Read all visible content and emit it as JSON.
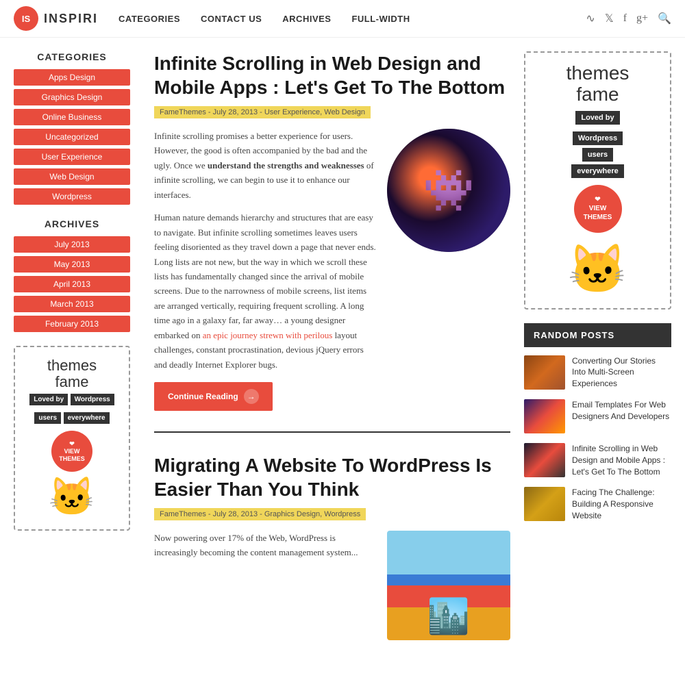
{
  "header": {
    "logo_initials": "IS",
    "logo_name": "INSPIRI",
    "nav": [
      {
        "label": "CATEGORIES",
        "id": "nav-categories"
      },
      {
        "label": "CONTACT US",
        "id": "nav-contact"
      },
      {
        "label": "ARCHIVES",
        "id": "nav-archives"
      },
      {
        "label": "FULL-WIDTH",
        "id": "nav-fullwidth"
      }
    ],
    "icons": [
      "rss-icon",
      "twitter-icon",
      "facebook-icon",
      "gplus-icon",
      "search-icon"
    ]
  },
  "sidebar": {
    "categories_title": "CATEGORIES",
    "categories": [
      "Apps Design",
      "Graphics Design",
      "Online Business",
      "Uncategorized",
      "User Experience",
      "Web Design",
      "Wordpress"
    ],
    "archives_title": "ARCHIVES",
    "archives": [
      "July 2013",
      "May 2013",
      "April 2013",
      "March 2013",
      "February 2013"
    ],
    "ad": {
      "script_line1": "themes",
      "script_line2": "fame",
      "tagline1": "Loved by",
      "tagline2": "Wordpress",
      "tagline3": "users",
      "tagline4": "everywhere",
      "badge_line1": "❤",
      "badge_line2": "VIEW",
      "badge_line3": "THEMES"
    }
  },
  "articles": [
    {
      "title": "Infinite Scrolling in Web Design and Mobile Apps : Let's Get To The Bottom",
      "meta": "FameThemes - July 28, 2013 - User Experience, Web Design",
      "body_p1": "Infinite scrolling promises a better experience for users. However, the good is often accompanied by the bad and the ugly. Once we ",
      "bold_text": "understand the strengths and weaknesses",
      "body_p1_end": " of infinite scrolling, we can begin to use it to enhance our interfaces.",
      "body_p2": "Human nature demands hierarchy and structures that are easy to navigate. But infinite scrolling sometimes leaves users feeling disoriented as they travel down a page that never ends. Long lists are not new, but the way in which we scroll these lists has fundamentally changed since the arrival of mobile screens. Due to the narrowness of mobile screens, list items are arranged vertically, requiring frequent scrolling. A long time ago in a galaxy far, far away… a young designer embarked on an epic journey strewn with perilous layout challenges, constant procrastination, devious jQuery errors and deadly Internet Explorer bugs.",
      "link_text1": "an epic journey strewn with peri",
      "link_text2": "lous",
      "continue_label": "Continue Reading"
    },
    {
      "title": "Migrating A Website To WordPress Is Easier Than You Think",
      "meta": "FameThemes - July 28, 2013 - Graphics Design, Wordpress",
      "body_p1": "Now powering over 17% of the Web, WordPress is increasingly becoming the content management system..."
    }
  ],
  "right_sidebar": {
    "ad": {
      "script_line1": "themes",
      "script_line2": "fame",
      "tagline1": "Loved by",
      "tagline2": "Wordpress",
      "tagline3": "users",
      "tagline4": "everywhere",
      "badge_line1": "❤",
      "badge_line2": "VIEW",
      "badge_line3": "THEMES"
    },
    "random_posts_title": "RANDOM POSTS",
    "random_posts": [
      {
        "title": "Converting Our Stories Into Multi-Screen Experiences",
        "thumb_class": "thumb1"
      },
      {
        "title": "Email Templates For Web Designers And Developers",
        "thumb_class": "thumb2"
      },
      {
        "title": "Infinite Scrolling in Web Design and Mobile Apps : Let's Get To The Bottom",
        "thumb_class": "thumb3"
      },
      {
        "title": "Facing The Challenge: Building A Responsive Website",
        "thumb_class": "thumb4"
      }
    ]
  }
}
